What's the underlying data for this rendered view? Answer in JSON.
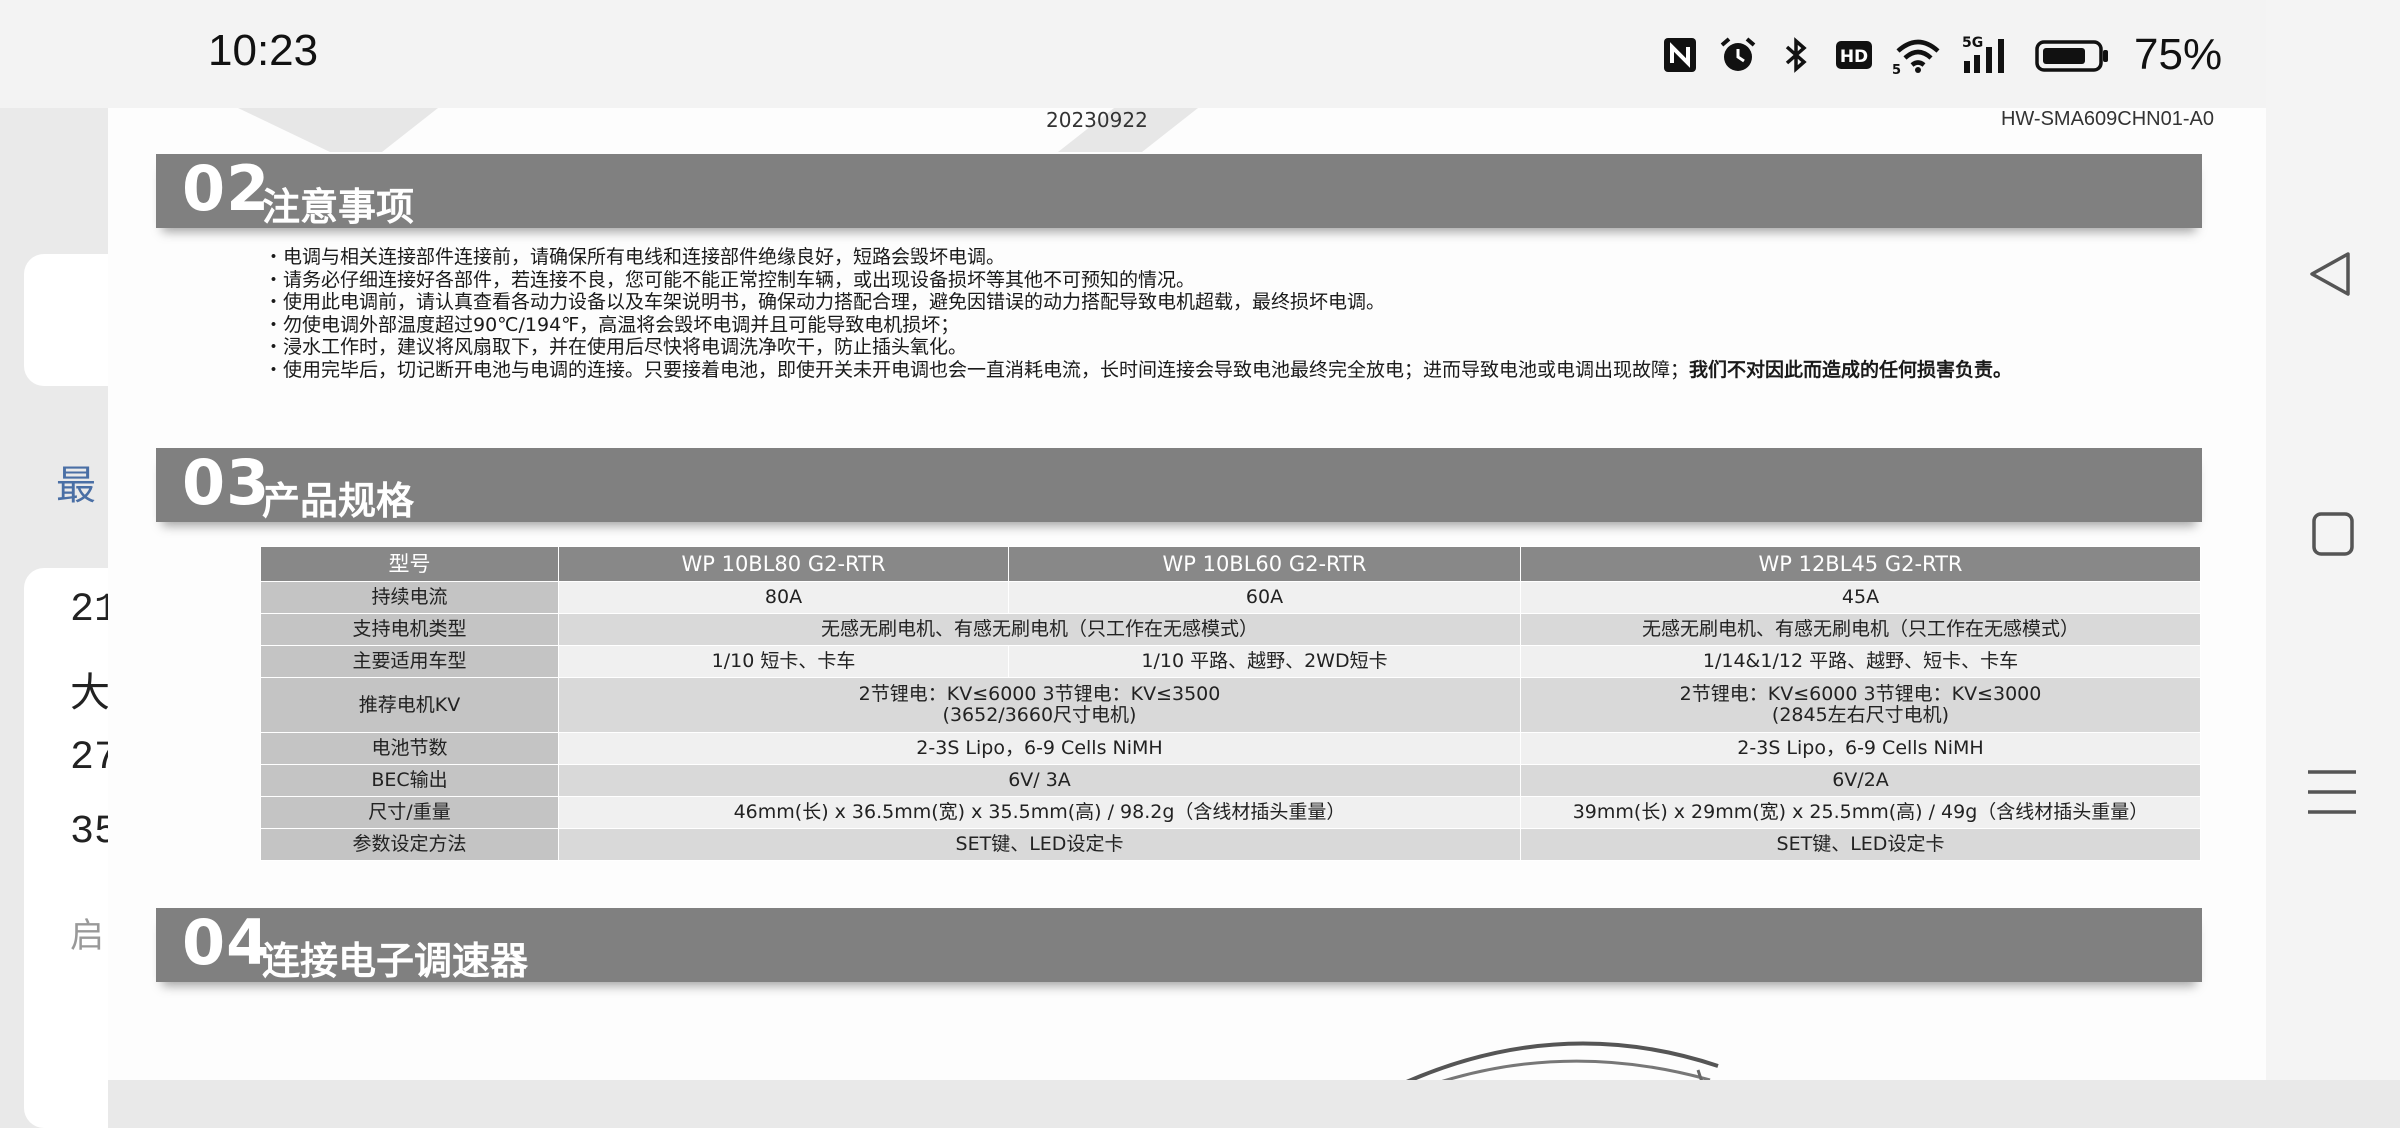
{
  "status_bar": {
    "time": "10:23",
    "icons": [
      "nfc-icon",
      "alarm-icon",
      "bluetooth-icon",
      "hd-icon",
      "wifi-icon",
      "signal-5g-icon",
      "battery-icon"
    ],
    "battery_percent": "75%",
    "signal_label": "5G",
    "hd_label": "HD"
  },
  "nav": {
    "buttons": [
      "back-triangle-icon",
      "home-square-icon",
      "menu-lines-icon"
    ]
  },
  "background_app": {
    "partial_texts": [
      "最",
      "21",
      "大",
      "27",
      "35",
      "启"
    ]
  },
  "document": {
    "date": "20230922",
    "code": "HW-SMA609CHN01-A0",
    "sections": [
      {
        "num": "02",
        "title": "注意事项"
      },
      {
        "num": "03",
        "title": "产品规格"
      },
      {
        "num": "04",
        "title": "连接电子调速器"
      }
    ],
    "notes": [
      "・电调与相关连接部件连接前，请确保所有电线和连接部件绝缘良好，短路会毁坏电调。",
      "・请务必仔细连接好各部件，若连接不良，您可能不能正常控制车辆，或出现设备损坏等其他不可预知的情况。",
      "・使用此电调前，请认真查看各动力设备以及车架说明书，确保动力搭配合理，避免因错误的动力搭配导致电机超载，最终损坏电调。",
      "・勿使电调外部温度超过90℃/194℉，高温将会毁坏电调并且可能导致电机损坏；",
      "・浸水工作时，建议将风扇取下，并在使用后尽快将电调洗净吹干，防止插头氧化。",
      "・使用完毕后，切记断开电池与电调的连接。只要接着电池，即使开关未开电调也会一直消耗电流，长时间连接会导致电池最终完全放电；进而导致电池或电调出现故障；"
    ],
    "notes_bold_tail": "我们不对因此而造成的任何损害负责。",
    "spec_table": {
      "headers": [
        "型号",
        "WP 10BL80 G2-RTR",
        "WP 10BL60 G2-RTR",
        "WP 12BL45 G2-RTR"
      ],
      "rows": {
        "continuous_current": {
          "label": "持续电流",
          "a": "80A",
          "b": "60A",
          "c": "45A"
        },
        "motor_type": {
          "label": "支持电机类型",
          "ab": "无感无刷电机、有感无刷电机（只工作在无感模式）",
          "c": "无感无刷电机、有感无刷电机（只工作在无感模式）"
        },
        "vehicle": {
          "label": "主要适用车型",
          "a": "1/10 短卡、卡车",
          "b": "1/10 平路、越野、2WD短卡",
          "c": "1/14&1/12 平路、越野、短卡、卡车"
        },
        "kv": {
          "label": "推荐电机KV",
          "ab_line1": "2节锂电：KV≤6000   3节锂电：KV≤3500",
          "ab_line2": "(3652/3660尺寸电机)",
          "c_line1": "2节锂电：KV≤6000  3节锂电：KV≤3000",
          "c_line2": "(2845左右尺寸电机)"
        },
        "cells": {
          "label": "电池节数",
          "ab": "2-3S Lipo，6-9 Cells NiMH",
          "c": "2-3S Lipo，6-9 Cells NiMH"
        },
        "bec": {
          "label": "BEC输出",
          "ab": "6V/ 3A",
          "c": "6V/2A"
        },
        "size": {
          "label": "尺寸/重量",
          "ab": "46mm(长) x 36.5mm(宽) x 35.5mm(高) / 98.2g（含线材插头重量）",
          "c": "39mm(长) x 29mm(宽) x 25.5mm(高) / 49g（含线材插头重量）"
        },
        "setting": {
          "label": "参数设定方法",
          "ab": "SET键、LED设定卡",
          "c": "SET键、LED设定卡"
        }
      }
    }
  }
}
